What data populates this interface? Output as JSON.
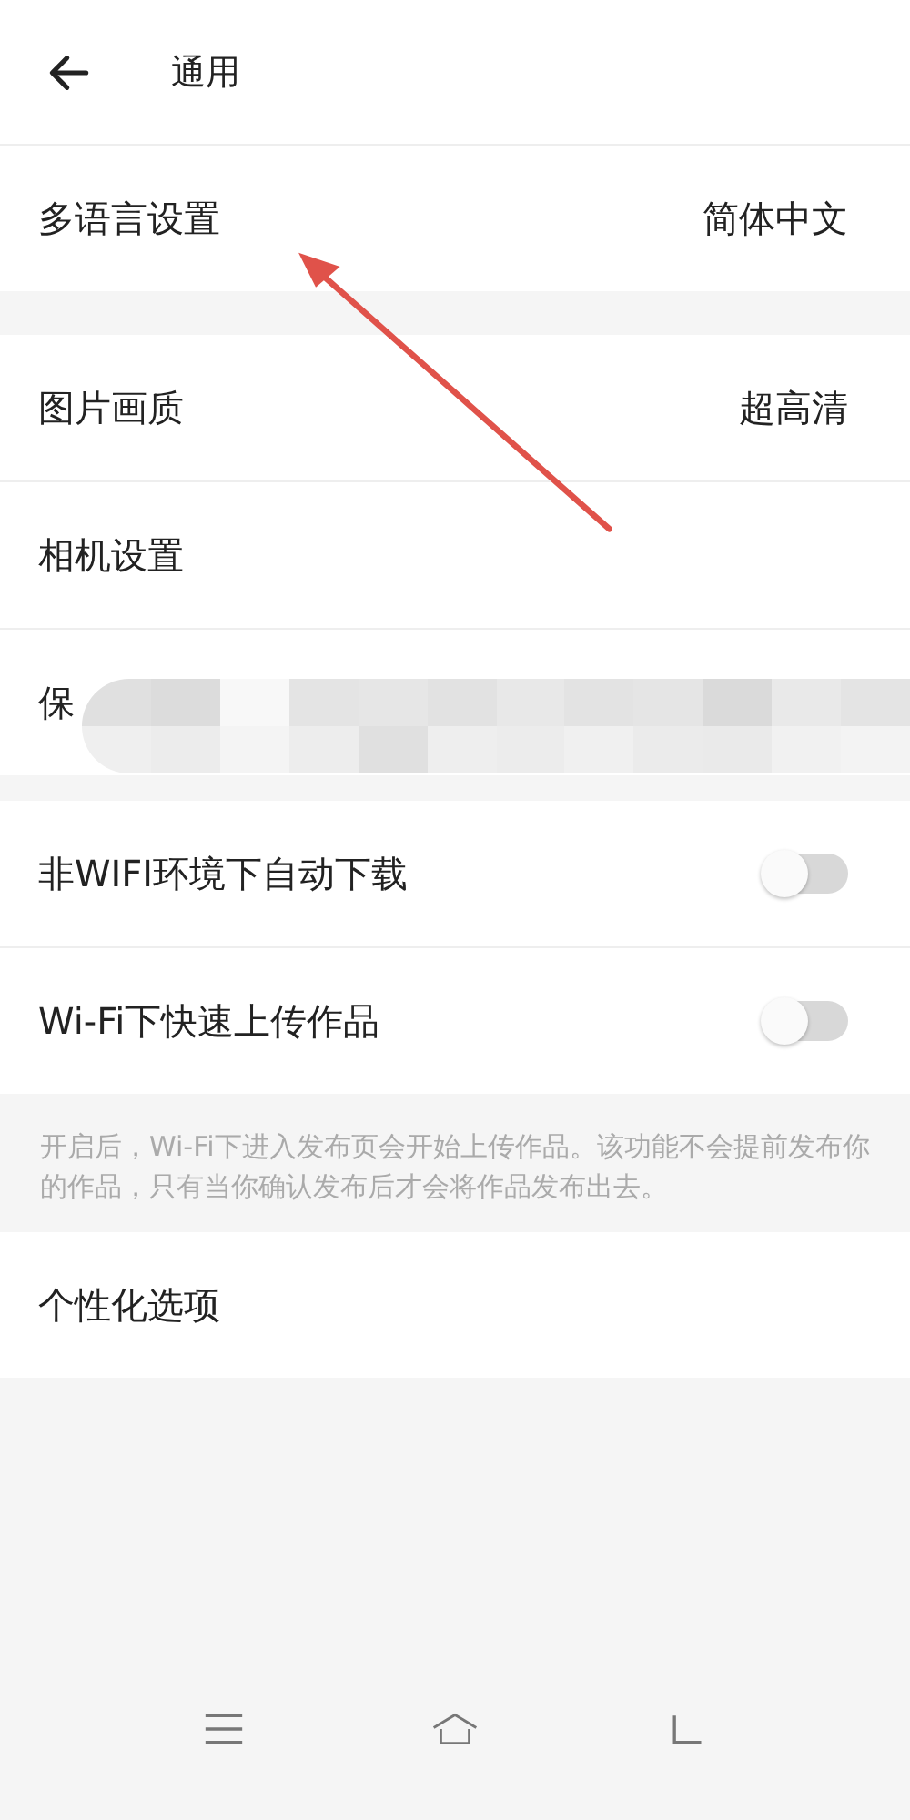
{
  "header": {
    "title": "通用"
  },
  "groups": [
    {
      "kind": "plain",
      "rows": [
        {
          "kind": "value",
          "label": "多语言设置",
          "value": "简体中文"
        }
      ]
    },
    {
      "kind": "plain",
      "rows": [
        {
          "kind": "value",
          "label": "图片画质",
          "value": "超高清"
        },
        {
          "kind": "value",
          "label": "相机设置"
        },
        {
          "kind": "obscured",
          "label": "保"
        }
      ]
    },
    {
      "kind": "plain",
      "rows": [
        {
          "kind": "toggle",
          "label": "非WIFI环境下自动下载",
          "on": false
        },
        {
          "kind": "toggle",
          "label": "Wi-Fi下快速上传作品",
          "on": false
        }
      ]
    },
    {
      "kind": "note",
      "text": "开启后，Wi-Fi下进入发布页会开始上传作品。该功能不会提前发布你的作品，只有当你确认发布后才会将作品发布出去。"
    },
    {
      "kind": "plain",
      "rows": [
        {
          "kind": "value",
          "label": "个性化选项"
        }
      ]
    }
  ],
  "annotation": {
    "kind": "arrow"
  }
}
